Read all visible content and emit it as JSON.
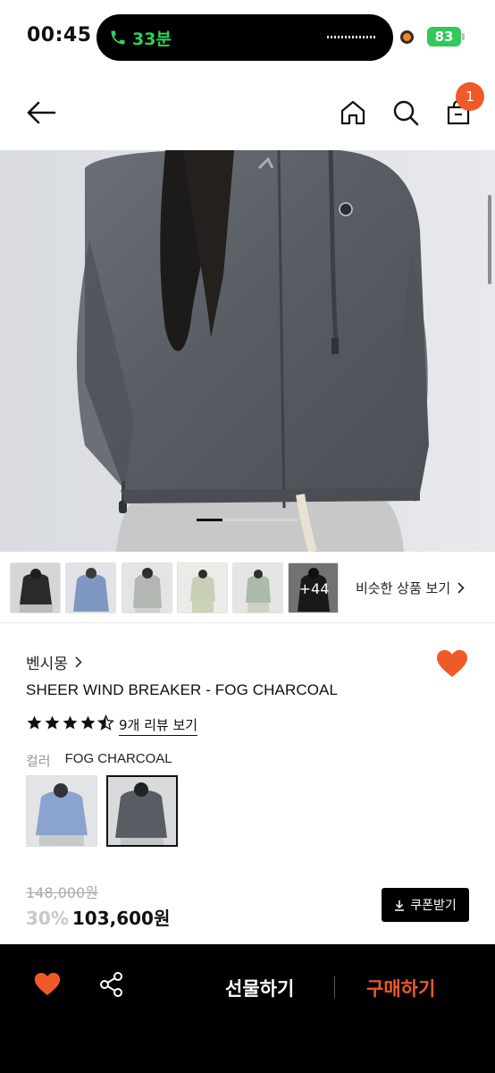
{
  "status_bar": {
    "time": "00:45",
    "call_duration": "33분",
    "battery": "83"
  },
  "header": {
    "cart_count": "1",
    "icons": [
      "back-arrow-icon",
      "home-icon",
      "search-icon",
      "shopping-bag-icon"
    ]
  },
  "gallery": {
    "more_count": "+44",
    "similar_label": "비슷한 상품 보기"
  },
  "product": {
    "brand": "벤시몽",
    "name": "SHEER WIND BREAKER - FOG CHARCOAL",
    "rating": 4.5,
    "review_link": "9개 리뷰 보기",
    "color_label": "컬러",
    "color_value": "FOG CHARCOAL",
    "original_price": "148,000원",
    "discount": "30%",
    "price": "103,600원",
    "coupon_label": "쿠폰받기",
    "liked": true
  },
  "bottom_bar": {
    "gift_label": "선물하기",
    "buy_label": "구매하기"
  },
  "colors": {
    "accent": "#ef5a28",
    "heart": "#ef5a28",
    "bottom_bar_bg": "#000000"
  }
}
